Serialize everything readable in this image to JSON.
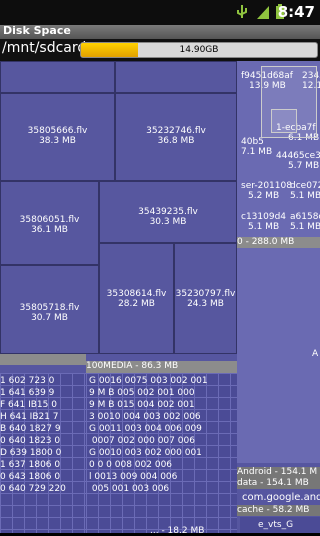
{
  "status": {
    "time": "8:47"
  },
  "app": {
    "title": "Disk Space"
  },
  "path": "/mnt/sdcard",
  "storage": {
    "label": "14.90GB",
    "used_fraction": 0.24
  },
  "blocks": [
    {
      "name": "35805666.flv",
      "size": "38.3 MB"
    },
    {
      "name": "35232746.flv",
      "size": "36.8 MB"
    },
    {
      "name": "35806051.flv",
      "size": "36.1 MB"
    },
    {
      "name": "35439235.flv",
      "size": "30.3 MB"
    },
    {
      "name": "35805718.flv",
      "size": "30.7 MB"
    },
    {
      "name": "35308614.flv",
      "size": "28.2 MB"
    },
    {
      "name": "35230797.flv",
      "size": "24.3 MB"
    }
  ],
  "right_panel": {
    "a1": "f9451d68af",
    "a1s": "13.9 MB",
    "a2": "2345",
    "a2s": "12.1",
    "b1": "40b5",
    "b1s": "7.1 MB",
    "b2": "1-ecba7f",
    "b2s": "6.1 MB",
    "b3": "44465ce3f",
    "b3s": "5.7 MB",
    "c1": "ser-201108",
    "c1s": "5.2 MB",
    "c2": "dce072",
    "c2s": "5.1 MB",
    "d1": "c13109d4",
    "d1s": "5.1 MB",
    "d2": "a6158c",
    "d2s": "5.1 MB",
    "hdr": "0 - 288.0 MB",
    "big": "A",
    "android": "Android - 154.1 M",
    "data": "data - 154.1 MB",
    "com": "com.google.andr",
    "cache": "cache - 58.2 MB",
    "vts": "e_vts_G"
  },
  "media_header": "100MEDIA - 86.3 MB",
  "grid_left": "1 602 723 0\n1 641 639 9\nF 641 IB15 0\nH 641 IB21 7\nB 640 1827 9\n0 640 1823 0\nD 639 1800 0\n1 637 1806 0\n0 643 1806 0\n0 640 729 220",
  "grid_right": "G 0016 0075 003 002 001\n9 M B 005 002 001 000\n9 M B 015 004 002 001\n3 0010 004 003 002 006\nG 0011 003 004 006 009\n 0007 002 000 007 006\nG 0010 003 002 000 001\n0 0 0 008 002 006\nl 0013 009 004 006\n 005 001 003 006",
  "bottom_label": "... - 18.2 MB"
}
